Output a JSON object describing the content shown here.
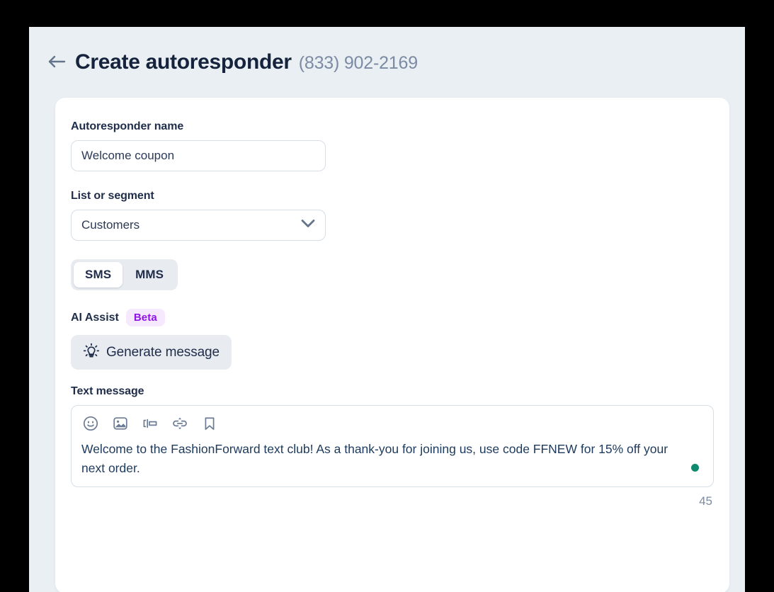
{
  "header": {
    "back_icon": "arrow-left-icon",
    "title": "Create autoresponder",
    "phone_number": "(833) 902-2169"
  },
  "form": {
    "name_field": {
      "label": "Autoresponder name",
      "value": "Welcome coupon",
      "placeholder": "Autoresponder name"
    },
    "list_field": {
      "label": "List or segment",
      "value": "Customers",
      "chevron_icon": "chevron-down-icon"
    },
    "message_type": {
      "options": [
        {
          "label": "SMS",
          "selected": true
        },
        {
          "label": "MMS",
          "selected": false
        }
      ]
    },
    "ai_assist": {
      "label": "AI Assist",
      "badge": "Beta",
      "badge_color": "#9013e8",
      "badge_bg": "#f7e9fd",
      "generate_button": {
        "label": "Generate message",
        "icon": "lightbulb-icon"
      }
    },
    "text_message": {
      "label": "Text message",
      "toolbar": [
        {
          "icon": "emoji-icon"
        },
        {
          "icon": "image-icon"
        },
        {
          "icon": "merge-field-icon"
        },
        {
          "icon": "link-icon"
        },
        {
          "icon": "bookmark-icon"
        }
      ],
      "value": "Welcome to the FashionForward text club! As a thank-you for joining us, use code FFNEW for 15% off your next order.",
      "status_dot_color": "#0e8a6e",
      "char_count": "45"
    }
  }
}
